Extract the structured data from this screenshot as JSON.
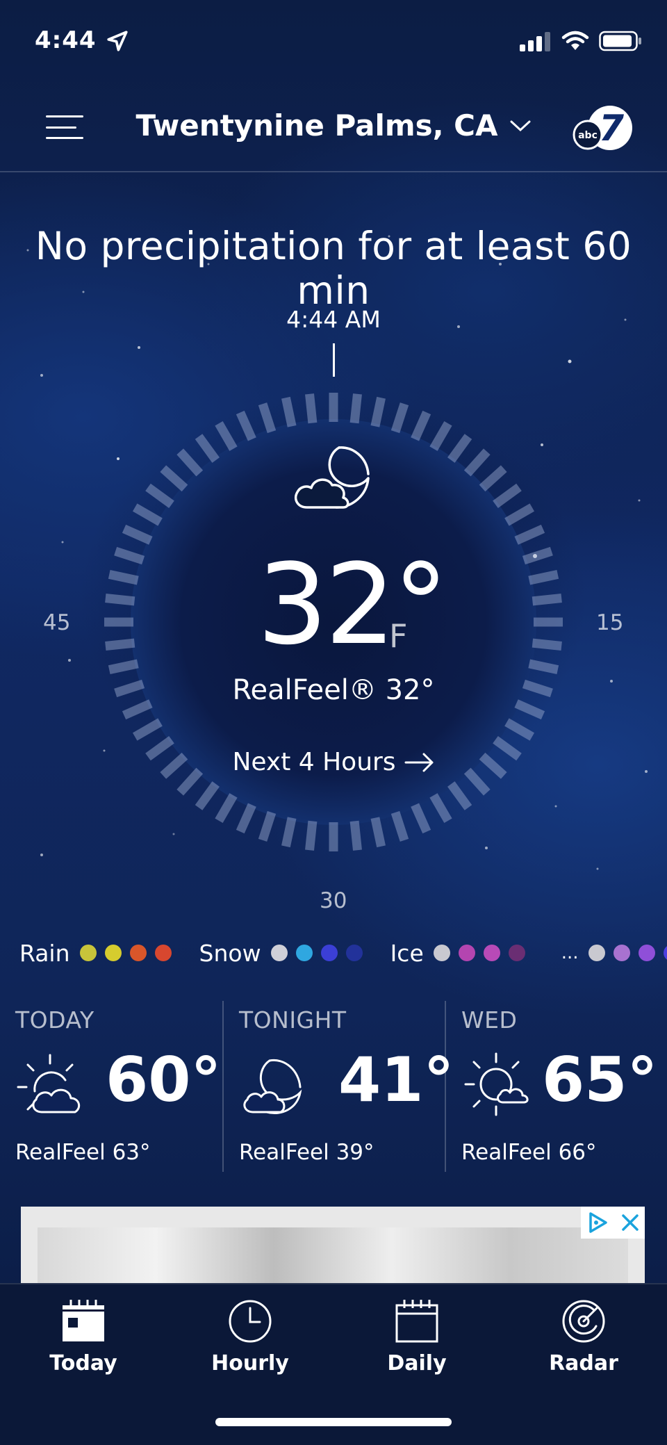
{
  "status_bar": {
    "time": "4:44"
  },
  "header": {
    "location": "Twentynine Palms, CA"
  },
  "minutecast": {
    "message": "No precipitation for at least 60 min"
  },
  "dial": {
    "time_label": "4:44 AM",
    "label_left": "45",
    "label_right": "15",
    "label_bottom": "30"
  },
  "current": {
    "temperature": "32°",
    "unit": "F",
    "realfeel": "RealFeel® 32°",
    "next_hours": "Next 4 Hours"
  },
  "legend": {
    "rain": {
      "label": "Rain",
      "colors": [
        "#c8c43a",
        "#d6cc2e",
        "#d9562a",
        "#d8472f"
      ]
    },
    "snow": {
      "label": "Snow",
      "colors": [
        "#d0d0d8",
        "#2fa7e0",
        "#3b3fd6",
        "#22329a"
      ]
    },
    "ice": {
      "label": "Ice",
      "colors": [
        "#c9c9d0",
        "#b445b0",
        "#b84ab7",
        "#6a2e73"
      ]
    },
    "mix": {
      "label": "...",
      "colors": [
        "#c9c9d0",
        "#a872d0",
        "#8f4fd8",
        "#4b3fe0"
      ]
    }
  },
  "forecast": [
    {
      "label": "TODAY",
      "temp": "60°",
      "realfeel": "RealFeel 63°",
      "icon": "partly-sunny-icon"
    },
    {
      "label": "TONIGHT",
      "temp": "41°",
      "realfeel": "RealFeel 39°",
      "icon": "partly-cloudy-night-icon"
    },
    {
      "label": "WED",
      "temp": "65°",
      "realfeel": "RealFeel 66°",
      "icon": "mostly-sunny-icon"
    }
  ],
  "tabs": [
    {
      "label": "Today",
      "icon": "calendar-today-icon"
    },
    {
      "label": "Hourly",
      "icon": "clock-icon"
    },
    {
      "label": "Daily",
      "icon": "calendar-icon"
    },
    {
      "label": "Radar",
      "icon": "radar-icon"
    }
  ]
}
